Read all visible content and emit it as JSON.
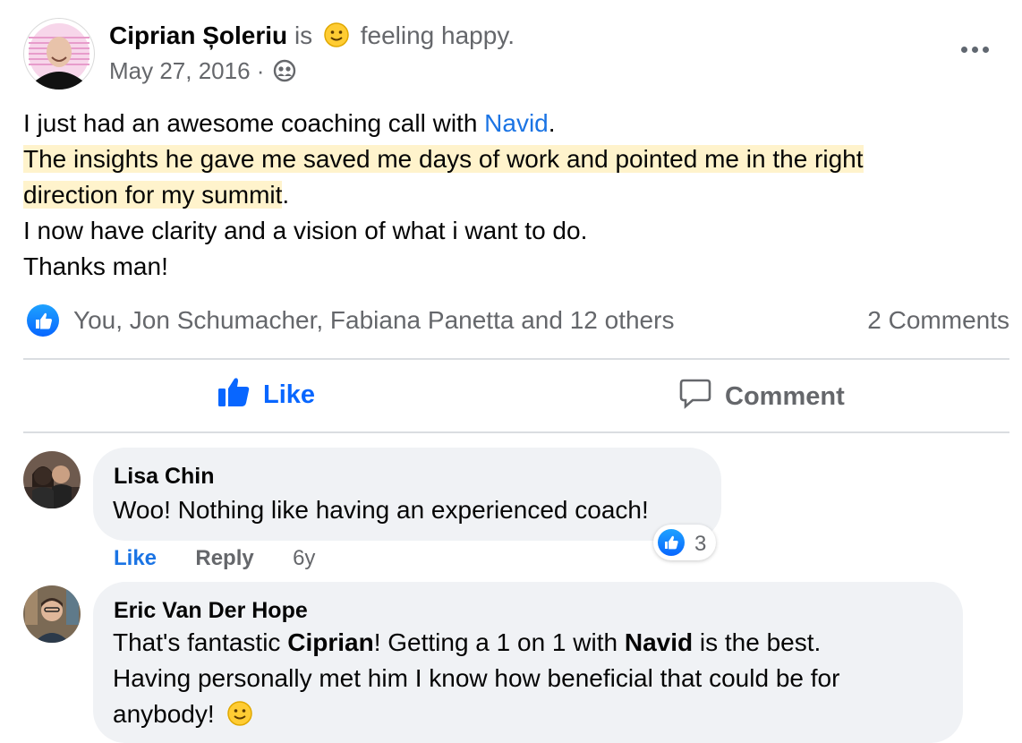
{
  "post": {
    "author": "Ciprian Șoleriu",
    "is_word": "is",
    "feeling": "feeling happy.",
    "date": "May 27, 2016 ·",
    "body": {
      "line1_before": "I just had an awesome coaching call with ",
      "line1_link": "Navid",
      "line1_after": ".",
      "line2_highlight": "The insights he gave me saved me days of work and pointed me in the right",
      "line3_highlight": "direction for my summit",
      "line3_after": ".",
      "line4": "I now have clarity and a vision of what i want to do.",
      "line5": "Thanks man!"
    },
    "reactors": "You, Jon Schumacher, Fabiana Panetta and 12 others",
    "comment_count": "2 Comments"
  },
  "actions": {
    "like": "Like",
    "comment": "Comment"
  },
  "comments": [
    {
      "name": "Lisa Chin",
      "text": "Woo! Nothing like having an experienced coach!",
      "like_label": "Like",
      "reply_label": "Reply",
      "age": "6y",
      "reaction_count": "3"
    },
    {
      "name": "Eric Van Der Hope",
      "text_p1": "That's fantastic ",
      "mention1": "Ciprian",
      "text_p2": "! Getting a 1 on 1 with ",
      "mention2": "Navid",
      "text_p3": " is the best.",
      "text_line2": "Having personally met him I know how beneficial that could be for",
      "text_line3": "anybody!"
    }
  ],
  "colors": {
    "accent": "#0866ff",
    "link": "#1b74e4",
    "muted": "#65676b",
    "highlight": "#fff3cc",
    "bubble": "#f0f2f5"
  }
}
